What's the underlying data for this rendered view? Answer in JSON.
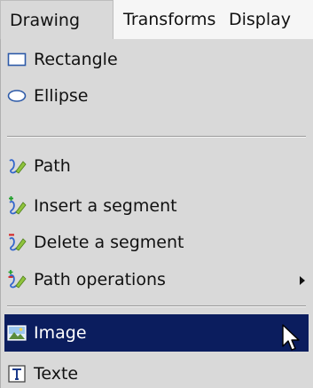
{
  "menubar": {
    "items": [
      {
        "label": "Drawing",
        "active": true
      },
      {
        "label": "Transforms",
        "active": false
      },
      {
        "label": "Display",
        "active": false
      }
    ]
  },
  "menu": {
    "items": [
      {
        "label": "Rectangle",
        "icon": "rectangle-icon"
      },
      {
        "label": "Ellipse",
        "icon": "ellipse-icon"
      },
      {
        "label": "Path",
        "icon": "path-icon"
      },
      {
        "label": "Insert a segment",
        "icon": "insert-segment-icon"
      },
      {
        "label": "Delete a segment",
        "icon": "delete-segment-icon"
      },
      {
        "label": "Path operations",
        "icon": "path-operations-icon",
        "has_submenu": true
      },
      {
        "label": "Image",
        "icon": "image-icon",
        "selected": true
      },
      {
        "label": "Texte",
        "icon": "text-icon"
      }
    ]
  },
  "colors": {
    "menu_background": "#d9d9d9",
    "selection_background": "#0b1d5e",
    "selection_text": "#ffffff"
  }
}
